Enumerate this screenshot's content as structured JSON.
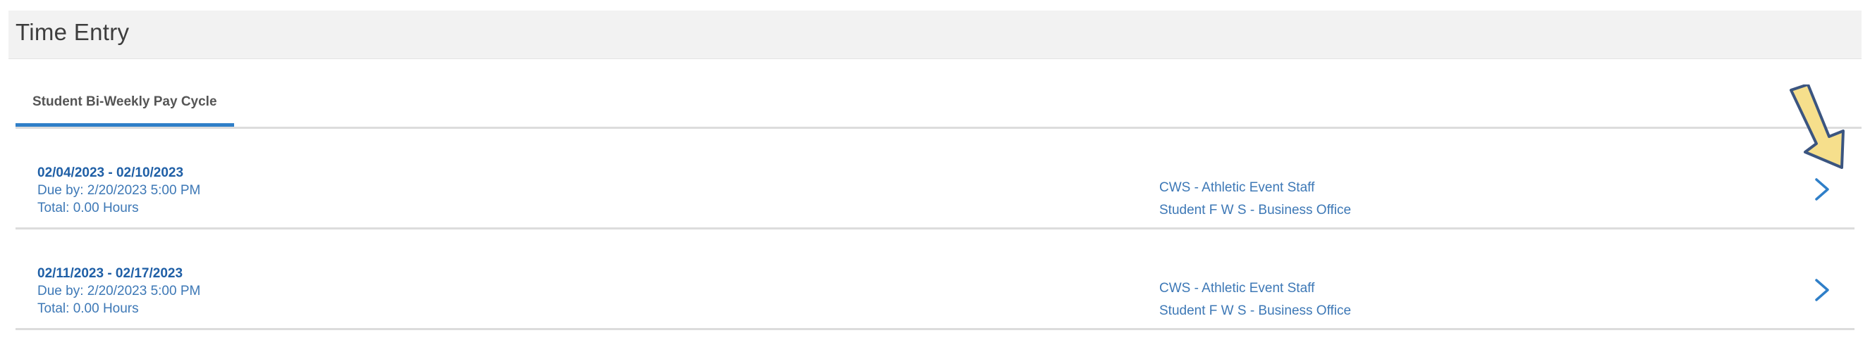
{
  "page": {
    "title": "Time Entry"
  },
  "tabs": [
    {
      "label": "Student Bi-Weekly Pay Cycle",
      "active": true
    }
  ],
  "periods": [
    {
      "range": "02/04/2023 - 02/10/2023",
      "due": "Due by: 2/20/2023 5:00 PM",
      "total": "Total: 0.00 Hours",
      "jobs": [
        "CWS - Athletic Event Staff",
        "Student F W S - Business Office"
      ]
    },
    {
      "range": "02/11/2023 - 02/17/2023",
      "due": "Due by: 2/20/2023 5:00 PM",
      "total": "Total: 0.00 Hours",
      "jobs": [
        "CWS - Athletic Event Staff",
        "Student F W S - Business Office"
      ]
    }
  ],
  "icons": {
    "chevron": "chevron-right-icon",
    "annotation": "arrow-down-icon"
  },
  "colors": {
    "accent": "#2f7fc8",
    "link": "#3d78b6",
    "annotation_fill": "#f6df8c",
    "annotation_stroke": "#3b5580"
  }
}
